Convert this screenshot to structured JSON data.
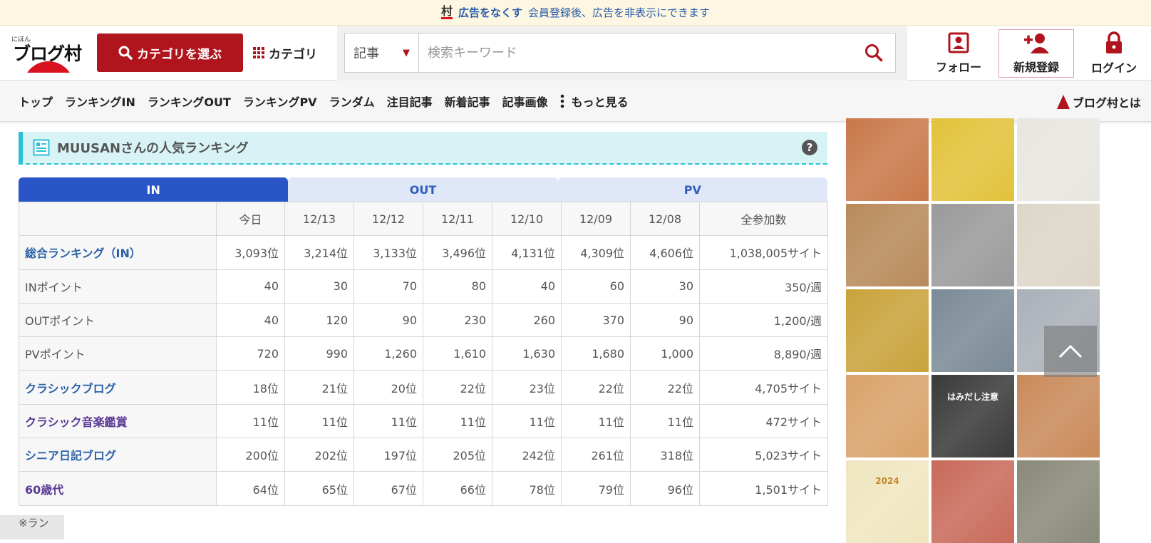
{
  "adbar": {
    "mura": "村",
    "remove_link": "広告をなくす",
    "note": "会員登録後、広告を非表示にできます"
  },
  "header": {
    "logo_small": "にほん",
    "logo_main": "ブログ村",
    "category_button": "カテゴリを選ぶ",
    "category_link": "カテゴリ",
    "search": {
      "select_value": "記事",
      "placeholder": "検索キーワード"
    },
    "follow": "フォロー",
    "register": "新規登録",
    "login": "ログイン"
  },
  "nav": {
    "items": [
      "トップ",
      "ランキングIN",
      "ランキングOUT",
      "ランキングPV",
      "ランダム",
      "注目記事",
      "新着記事",
      "記事画像"
    ],
    "more": "もっと見る",
    "about": "ブログ村とは"
  },
  "ranking": {
    "title": "MUUSANさんの人気ランキング",
    "help": "?",
    "tabs": [
      "IN",
      "OUT",
      "PV"
    ],
    "active_tab": "IN",
    "columns": [
      "",
      "今日",
      "12/13",
      "12/12",
      "12/11",
      "12/10",
      "12/09",
      "12/08",
      "全参加数"
    ],
    "rows": [
      {
        "label": "総合ランキング（IN）",
        "style": "link",
        "cells": [
          "3,093位",
          "3,214位",
          "3,133位",
          "3,496位",
          "4,131位",
          "4,309位",
          "4,606位",
          "1,038,005サイト"
        ]
      },
      {
        "label": "INポイント",
        "style": "plain",
        "cells": [
          "40",
          "30",
          "70",
          "80",
          "40",
          "60",
          "30",
          "350/週"
        ]
      },
      {
        "label": "OUTポイント",
        "style": "plain",
        "cells": [
          "40",
          "120",
          "90",
          "230",
          "260",
          "370",
          "90",
          "1,200/週"
        ]
      },
      {
        "label": "PVポイント",
        "style": "plain",
        "cells": [
          "720",
          "990",
          "1,260",
          "1,610",
          "1,630",
          "1,680",
          "1,000",
          "8,890/週"
        ]
      },
      {
        "label": "クラシックブログ",
        "style": "link",
        "cells": [
          "18位",
          "21位",
          "20位",
          "22位",
          "23位",
          "22位",
          "22位",
          "4,705サイト"
        ]
      },
      {
        "label": "クラシック音楽鑑賞",
        "style": "plink",
        "cells": [
          "11位",
          "11位",
          "11位",
          "11位",
          "11位",
          "11位",
          "11位",
          "472サイト"
        ]
      },
      {
        "label": "シニア日記ブログ",
        "style": "link",
        "cells": [
          "200位",
          "202位",
          "197位",
          "205位",
          "242位",
          "261位",
          "318位",
          "5,023サイト"
        ]
      },
      {
        "label": "60歳代",
        "style": "plink",
        "cells": [
          "64位",
          "65位",
          "67位",
          "66位",
          "78位",
          "79位",
          "96位",
          "1,501サイト"
        ]
      }
    ],
    "footnote": "※ラン"
  },
  "gallery": {
    "thumbs": [
      {
        "name": "thumb-spaghetti",
        "bg": "#c9784a"
      },
      {
        "name": "thumb-train-interior",
        "bg": "#e2c23a"
      },
      {
        "name": "thumb-newspaper",
        "bg": "#e8e6e0"
      },
      {
        "name": "thumb-noodle-soup",
        "bg": "#b88a5a"
      },
      {
        "name": "thumb-shop-building",
        "bg": "#9a9a9a"
      },
      {
        "name": "thumb-newspaper-2",
        "bg": "#ddd6c8"
      },
      {
        "name": "thumb-train-door",
        "bg": "#c9a23a"
      },
      {
        "name": "thumb-store-shelf",
        "bg": "#7a8a96"
      },
      {
        "name": "thumb-station",
        "bg": "#aab0b8"
      },
      {
        "name": "thumb-phones-sale",
        "bg": "#d9a26a"
      },
      {
        "name": "thumb-hamidashi",
        "bg": "#3a3a3a",
        "text": "はみだし注意"
      },
      {
        "name": "thumb-yakisoba",
        "bg": "#c98a5a"
      },
      {
        "name": "thumb-calendar",
        "bg": "#efe6c0",
        "text": "2024"
      },
      {
        "name": "thumb-snacks",
        "bg": "#c86a5a"
      },
      {
        "name": "thumb-railway",
        "bg": "#8a8a7a"
      }
    ]
  }
}
